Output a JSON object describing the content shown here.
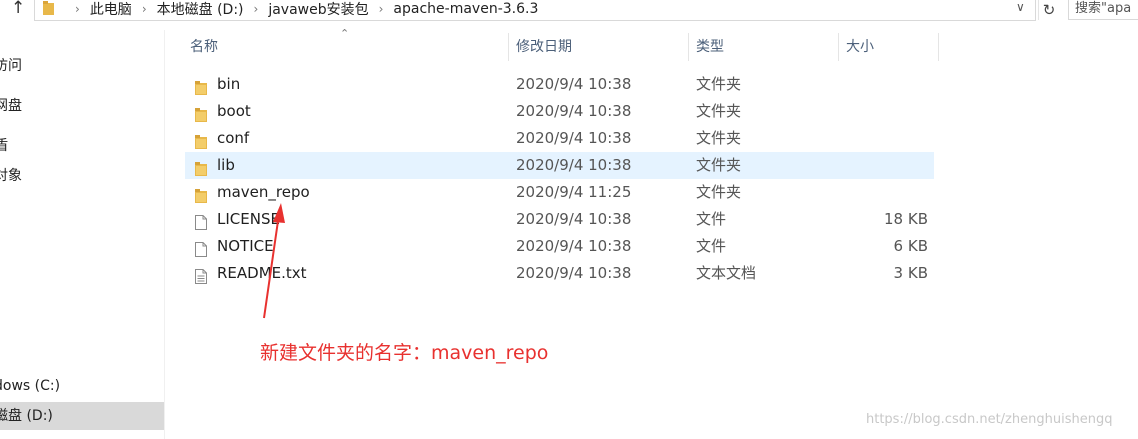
{
  "address_bar": {
    "breadcrumbs": [
      "此电脑",
      "本地磁盘 (D:)",
      "javaweb安装包",
      "apache-maven-3.6.3"
    ],
    "search_placeholder": "搜索\"apa"
  },
  "nav_pane": {
    "items": [
      {
        "label": "访问"
      },
      {
        "label": "网盘"
      },
      {
        "label": "盾"
      },
      {
        "label": "对象"
      },
      {
        "label": "dows (C:)"
      },
      {
        "label": "磁盘 (D:)",
        "selected": true
      }
    ]
  },
  "columns": {
    "name": "名称",
    "date": "修改日期",
    "type": "类型",
    "size": "大小"
  },
  "files": [
    {
      "name": "bin",
      "date": "2020/9/4 10:38",
      "type": "文件夹",
      "size": "",
      "icon": "folder-icon"
    },
    {
      "name": "boot",
      "date": "2020/9/4 10:38",
      "type": "文件夹",
      "size": "",
      "icon": "folder-icon"
    },
    {
      "name": "conf",
      "date": "2020/9/4 10:38",
      "type": "文件夹",
      "size": "",
      "icon": "folder-icon"
    },
    {
      "name": "lib",
      "date": "2020/9/4 10:38",
      "type": "文件夹",
      "size": "",
      "icon": "folder-icon",
      "hover": true
    },
    {
      "name": "maven_repo",
      "date": "2020/9/4 11:25",
      "type": "文件夹",
      "size": "",
      "icon": "folder-icon"
    },
    {
      "name": "LICENSE",
      "date": "2020/9/4 10:38",
      "type": "文件",
      "size": "18 KB",
      "icon": "file-icon"
    },
    {
      "name": "NOTICE",
      "date": "2020/9/4 10:38",
      "type": "文件",
      "size": "6 KB",
      "icon": "file-icon"
    },
    {
      "name": "README.txt",
      "date": "2020/9/4 10:38",
      "type": "文本文档",
      "size": "3 KB",
      "icon": "text-file-icon"
    }
  ],
  "annotation": {
    "text": "新建文件夹的名字：maven_repo",
    "color": "#e8312f"
  },
  "watermark": "https://blog.csdn.net/zhenghuishengq"
}
